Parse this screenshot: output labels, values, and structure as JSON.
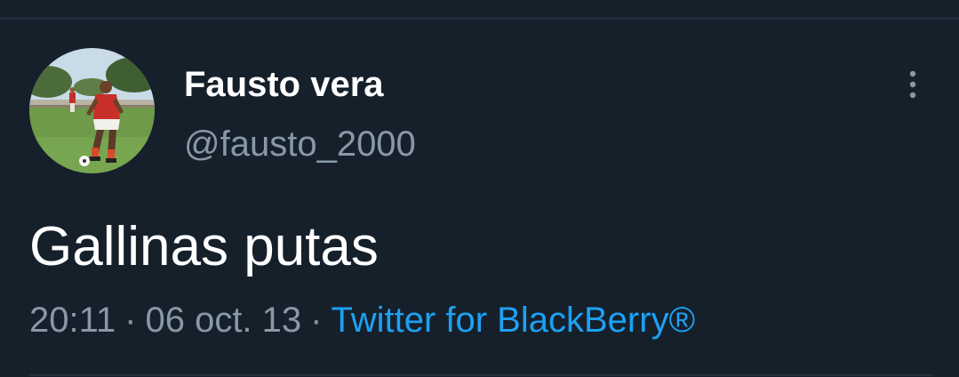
{
  "tweet": {
    "author": {
      "display_name": "Fausto vera",
      "handle": "@fausto_2000",
      "avatar_icon": "avatar-soccer-player"
    },
    "text": "Gallinas putas",
    "meta": {
      "time": "20:11",
      "separator": "·",
      "date": "06 oct. 13",
      "source": "Twitter for BlackBerry®"
    },
    "more_icon": "more-vertical-icon"
  },
  "colors": {
    "background": "#15202b",
    "primary_text": "#ffffff",
    "secondary_text": "#8899a6",
    "link": "#1da1f2",
    "divider": "#22303c"
  }
}
